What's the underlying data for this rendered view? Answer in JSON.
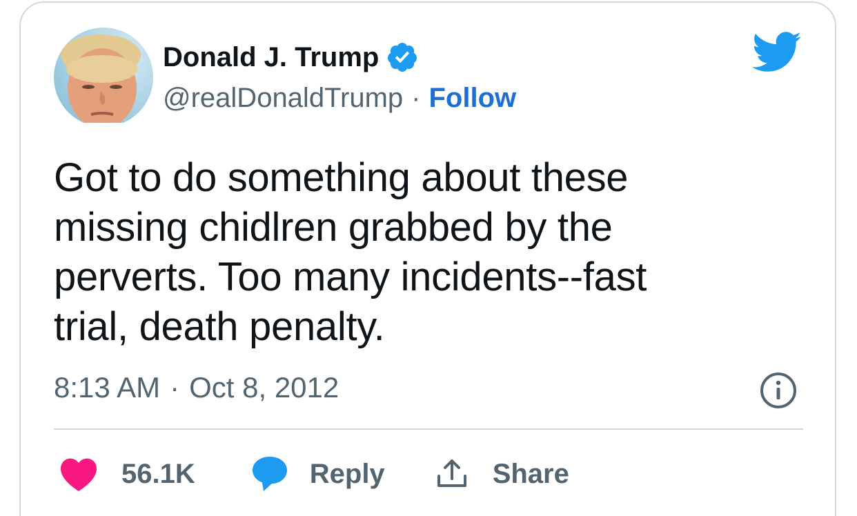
{
  "author": {
    "name": "Donald J. Trump",
    "handle": "@realDonaldTrump",
    "separator": "·",
    "follow_label": "Follow",
    "verified": true
  },
  "tweet": {
    "text": "Got to do something about these\nmissing chidlren grabbed by the\nperverts. Too many incidents--fast\ntrial, death penalty.",
    "time": "8:13 AM",
    "separator": "·",
    "date": "Oct 8, 2012"
  },
  "actions": {
    "like_count": "56.1K",
    "reply_label": "Reply",
    "share_label": "Share"
  },
  "icons": {
    "logo": "twitter-bird-icon",
    "verified": "verified-badge-icon",
    "info": "info-icon",
    "like": "heart-icon",
    "reply": "speech-bubble-icon",
    "share": "upload-arrow-icon"
  },
  "colors": {
    "text": "#0f1419",
    "secondary": "#536471",
    "link": "#1d6fd1",
    "twitter_blue": "#1d9bf0",
    "like": "#f91880",
    "border": "#cfd9de"
  }
}
